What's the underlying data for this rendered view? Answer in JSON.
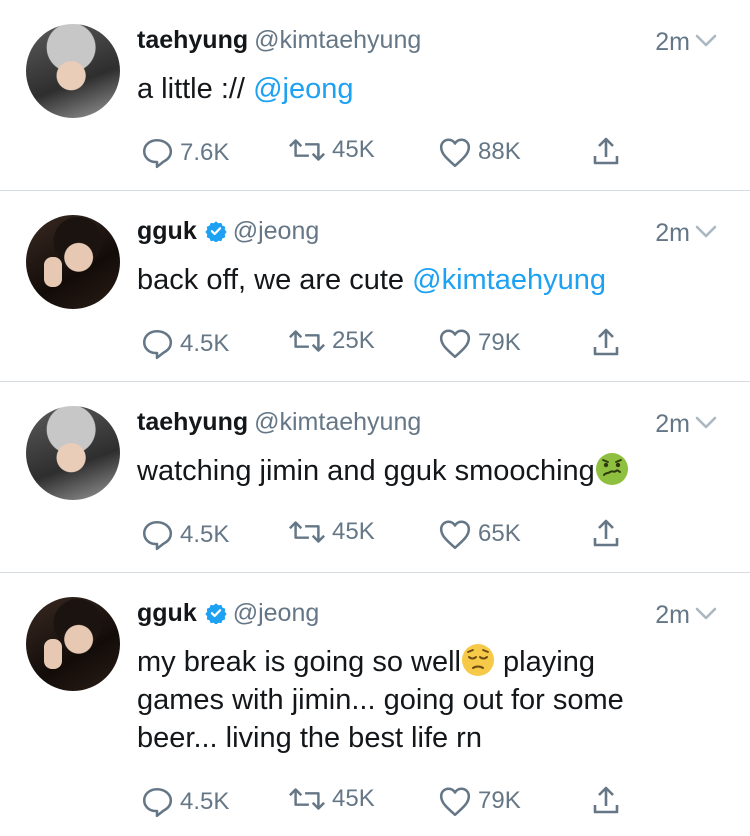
{
  "colors": {
    "accent": "#1da1f2",
    "text": "#14171a",
    "muted": "#657786"
  },
  "tweets": [
    {
      "name": "taehyung",
      "handle": "@kimtaehyung",
      "verified": false,
      "time": "2m",
      "text": "a little ://",
      "mention": "@jeong",
      "replies": "7.6K",
      "retweets": "45K",
      "likes": "88K"
    },
    {
      "name": "gguk",
      "handle": "@jeong",
      "verified": true,
      "time": "2m",
      "text": "back off, we are cute",
      "mention": "@kimtaehyung",
      "replies": "4.5K",
      "retweets": "25K",
      "likes": "79K"
    },
    {
      "name": "taehyung",
      "handle": "@kimtaehyung",
      "verified": false,
      "time": "2m",
      "text": "watching jimin and gguk smooching",
      "emoji": "nauseated-face",
      "replies": "4.5K",
      "retweets": "45K",
      "likes": "65K"
    },
    {
      "name": "gguk",
      "handle": "@jeong",
      "verified": true,
      "time": "2m",
      "text_line1": "my break is going so well",
      "emoji": "pensive-face",
      "text_line1b": "playing",
      "text_line2": "games with jimin... going out for some",
      "text_line3": "beer... living the best life rn",
      "replies": "4.5K",
      "retweets": "45K",
      "likes": "79K"
    }
  ]
}
